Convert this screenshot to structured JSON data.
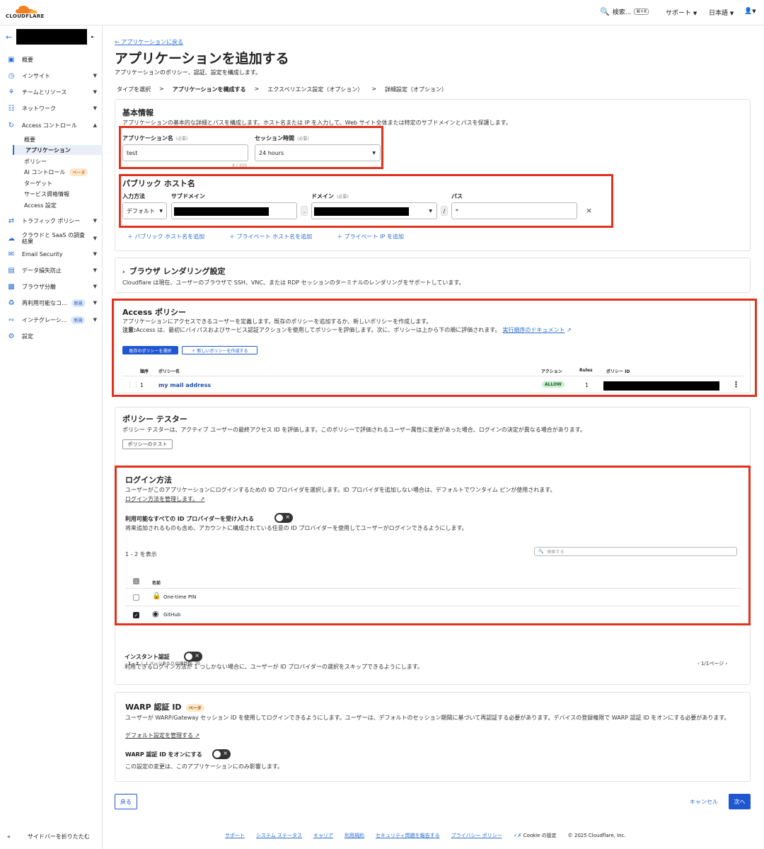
{
  "topbar": {
    "logo_text": "CLOUDFLARE",
    "search_label": "検索...",
    "search_shortcut": "⌘+K",
    "support": "サポート",
    "language": "日本語"
  },
  "sidebar": {
    "items": [
      {
        "label": "概要",
        "icon": "overview-icon"
      },
      {
        "label": "インサイト",
        "icon": "insights-icon"
      },
      {
        "label": "チームとリソース",
        "icon": "team-icon"
      },
      {
        "label": "ネットワーク",
        "icon": "network-icon"
      },
      {
        "label": "Access コントロール",
        "icon": "access-icon"
      }
    ],
    "sub_items": [
      "概要",
      "アプリケーション",
      "ポリシー",
      "AI コントロール",
      "ターゲット",
      "サービス資格情報",
      "Access 設定"
    ],
    "ai_badge": "ベータ",
    "items_after": [
      {
        "label": "トラフィック ポリシー",
        "icon": "traffic-icon"
      },
      {
        "label": "クラウドと SaaS の調査結果",
        "icon": "cloud-icon"
      },
      {
        "label": "Email Security",
        "icon": "email-icon"
      },
      {
        "label": "データ損失防止",
        "icon": "dlp-icon"
      },
      {
        "label": "ブラウザ分離",
        "icon": "browser-icon"
      },
      {
        "label": "再利用可能なコ...",
        "icon": "reuse-icon",
        "badge": "新規"
      },
      {
        "label": "インテグレーシ...",
        "icon": "integration-icon",
        "badge": "新規"
      },
      {
        "label": "設定",
        "icon": "settings-icon"
      }
    ],
    "collapse_label": "サイドバーを折りたたむ"
  },
  "header": {
    "back_link": "← アプリケーションに戻る",
    "title": "アプリケーションを追加する",
    "subtitle": "アプリケーションのポリシー、認証、設定を構成します。",
    "steps": [
      "タイプを選択",
      "アプリケーションを構成する",
      "エクスペリエンス設定（オプション）",
      "詳細設定（オプション）"
    ]
  },
  "basic": {
    "title": "基本情報",
    "desc": "アプリケーションの基本的な詳細とパスを構成します。ホスト名または IP を入力して、Web サイト全体または特定のサブドメインとパスを保護します。",
    "app_name_label": "アプリケーション名",
    "required": "(必要)",
    "app_name_value": "test",
    "counter": "4 / 350",
    "session_label": "セッション時間",
    "session_value": "24 hours",
    "public_host_title": "パブリック ホスト名",
    "input_method_label": "入力方法",
    "subdomain_label": "サブドメイン",
    "domain_label": "ドメイン",
    "path_label": "パス",
    "input_method_value": "デフォルト",
    "path_value": "*",
    "add_public": "パブリック ホスト名を追加",
    "add_private": "プライベート ホスト名を追加",
    "add_private_ip": "プライベート IP を追加"
  },
  "browser_rendering": {
    "title": "ブラウザ レンダリング設定",
    "desc": "Cloudflare は現在、ユーザーのブラウザで SSH、VNC、または RDP セッションのターミナルのレンダリングをサポートしています。"
  },
  "policies": {
    "title": "Access ポリシー",
    "desc": "アプリケーションにアクセスできるユーザーを定義します。既存のポリシーを追加するか、新しいポリシーを作成します。",
    "note_label": "注意:",
    "note": "Access は、最初にバイパスおよびサービス認証アクションを使用してポリシーを評価します。次に、ポリシーは上から下の順に評価されます。",
    "doc_link": "実行順序のドキュメント",
    "select_btn": "既存のポリシーを選択",
    "create_btn": "新しいポリシーを作成する",
    "columns": [
      "順序",
      "ポリシー名",
      "アクション",
      "Rules",
      "ポリシー ID"
    ],
    "rows": [
      {
        "order": "1",
        "name": "my mail address",
        "action": "ALLOW",
        "rules": "1"
      }
    ]
  },
  "tester": {
    "title": "ポリシー テスター",
    "desc": "ポリシー テスターは、アクティブ ユーザーの最終アクセス ID を評価します。このポリシーで評価されるユーザー属性に変更があった場合、ログインの決定が異なる場合があります。",
    "btn": "ポリシーのテスト"
  },
  "login": {
    "title": "ログイン方法",
    "desc": "ユーザーがこのアプリケーションにログインするための ID プロバイダを選択します。ID プロバイダを追加しない場合は、デフォルトでワンタイム ピンが使用されます。",
    "manage_link": "ログイン方法を管理します。",
    "accept_all_label": "利用可能なすべての ID プロバイダーを受け入れる",
    "accept_all_desc": "将来追加されるものも含め、アカウントに構成されている任意の ID プロバイダーを使用してユーザーがログインできるようにします。",
    "count": "1 - 2 を表示",
    "search_placeholder": "検索する",
    "name_col": "名前",
    "providers": [
      {
        "name": "One-time PIN",
        "checked": false
      },
      {
        "name": "GitHub",
        "checked": true
      }
    ],
    "pager_range": "1 - 2",
    "per_page": "1 ページあたりの項目数: 20",
    "page_info": "1/1ページ",
    "instant_label": "インスタント認証",
    "instant_desc": "利用できるログイン方法が 1 つしかない場合に、ユーザーが ID プロバイダーの選択をスキップできるようにします。"
  },
  "warp": {
    "title": "WARP 認証 ID",
    "badge": "ベータ",
    "desc": "ユーザーが WARP/Gateway セッション ID を使用してログインできるようにします。ユーザーは、デフォルトのセッション期間に基づいて再認証する必要があります。デバイスの登録権限で WARP 認証 ID をオンにする必要があります。",
    "manage_link": "デフォルト設定を管理する",
    "toggle_label": "WARP 認証 ID をオンにする",
    "toggle_desc": "この設定の変更は、このアプリケーションにのみ影響します。"
  },
  "actions": {
    "back": "戻る",
    "cancel": "キャンセル",
    "next": "次へ"
  },
  "footer": {
    "links": [
      "サポート",
      "システム ステータス",
      "キャリア",
      "利用規約",
      "セキュリティ問題を報告する",
      "プライバシー ポリシー"
    ],
    "cookie": "Cookie の設定",
    "copyright": "© 2025 Cloudflare, Inc."
  }
}
